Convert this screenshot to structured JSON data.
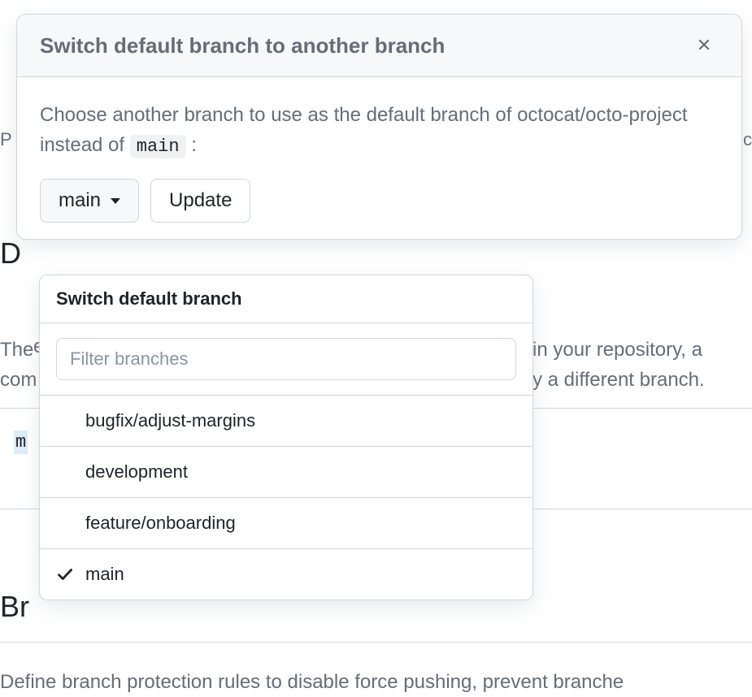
{
  "modal": {
    "title": "Switch default branch to another branch",
    "description_prefix": "Choose another branch to use as the default branch of octocat/octo-project instead of ",
    "current_branch_code": "main",
    "description_suffix": " :",
    "branch_selector_label": "main",
    "update_label": "Update"
  },
  "dropdown": {
    "title": "Switch default branch",
    "filter_placeholder": "Filter branches",
    "items": [
      {
        "label": "bugfix/adjust-margins",
        "selected": false
      },
      {
        "label": "development",
        "selected": false
      },
      {
        "label": "feature/onboarding",
        "selected": false
      },
      {
        "label": "main",
        "selected": true
      }
    ]
  },
  "background": {
    "char_p": "P",
    "char_c": "c",
    "char_e": "e",
    "heading_d": "D",
    "text_the": "The",
    "text_com": "com",
    "text_right_1": "in your repository, a",
    "text_right_2": "y a different branch.",
    "char_m": "m",
    "heading_br": "Br",
    "text_bottom": "Define branch protection rules to disable force pushing, prevent branche"
  }
}
